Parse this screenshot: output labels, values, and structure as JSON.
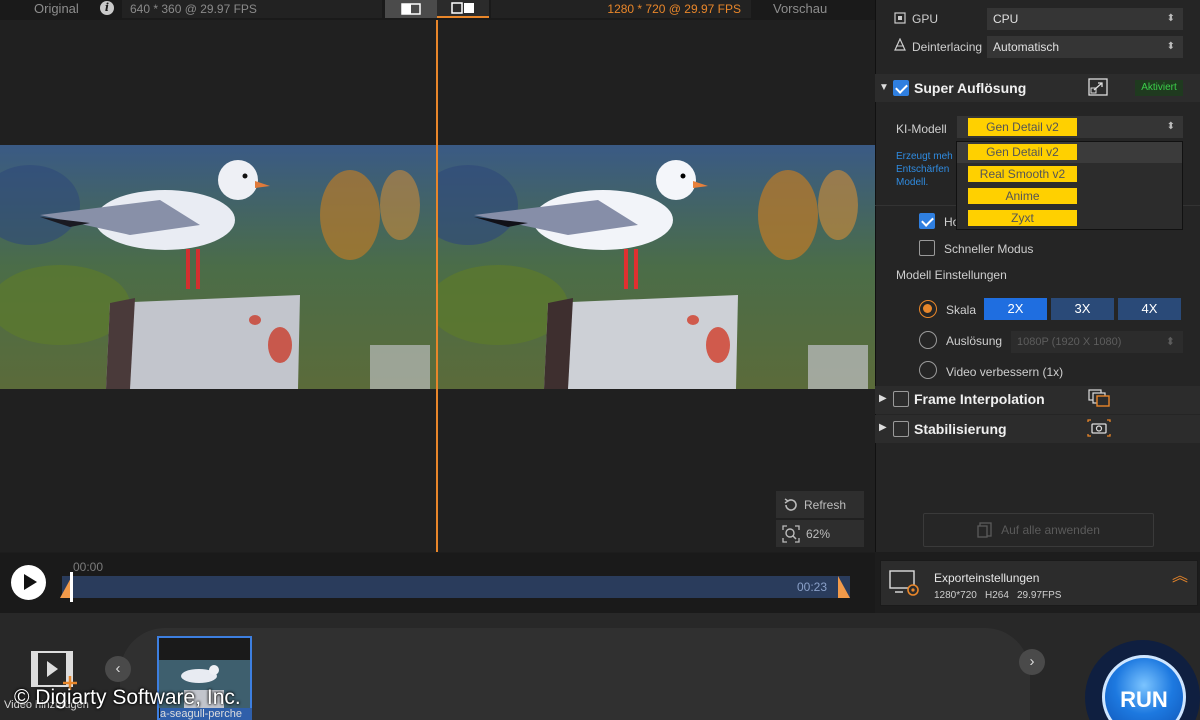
{
  "top_bar": {
    "original_label": "Original",
    "info_glyph": "i",
    "original_res": "640 * 360 @ 29.97 FPS",
    "preview_res": "1280 * 720 @ 29.97 FPS",
    "preview_label": "Vorschau"
  },
  "video_tools": {
    "refresh_label": "Refresh",
    "zoom_label": "62%"
  },
  "timeline": {
    "start_time": "00:00",
    "end_time": "00:23",
    "position": 0.01
  },
  "settings": {
    "gpu_label": "GPU",
    "gpu_value": "CPU",
    "deinterlacing_label": "Deinterlacing",
    "deinterlacing_value": "Automatisch",
    "super_resolution": {
      "title": "Super Auflösung",
      "enabled": true,
      "badge": "Aktiviert",
      "model_label": "KI-Modell",
      "model_value": "Gen Detail v2",
      "desc_line1": "Erzeugt meh",
      "desc_line2": "Entschärfen",
      "desc_line3": "Modell.",
      "model_options": [
        "Gen Detail v2",
        "Real Smooth v2",
        "Anime",
        "Zyxt"
      ],
      "checkbox1_label": "Ho",
      "checkbox2_label": "Schneller Modus",
      "model_settings_label": "Modell Einstellungen",
      "scale_label": "Skala",
      "scale_options": [
        "2X",
        "3X",
        "4X"
      ],
      "scale_selected": "2X",
      "resolution_label": "Auslösung",
      "resolution_value": "1080P (1920 X 1080)",
      "enhance_label": "Video verbessern (1x)"
    },
    "frame_interpolation": {
      "title": "Frame Interpolation",
      "enabled": false
    },
    "stabilization": {
      "title": "Stabilisierung",
      "enabled": false
    },
    "apply_all_label": "Auf alle anwenden"
  },
  "export": {
    "title": "Exporteinstellungen",
    "resolution": "1280*720",
    "codec": "H264",
    "fps": "29.97FPS"
  },
  "bottom": {
    "add_video_label": "Video hinzufügen",
    "thumb_label": "a-seagull-perche",
    "run_label": "RUN",
    "copyright": "© Digiarty Software, Inc."
  },
  "colors": {
    "accent_orange": "#e8862a",
    "accent_blue": "#1f6ee0",
    "model_yellow": "#ffd000",
    "active_green": "#3bd14a"
  }
}
